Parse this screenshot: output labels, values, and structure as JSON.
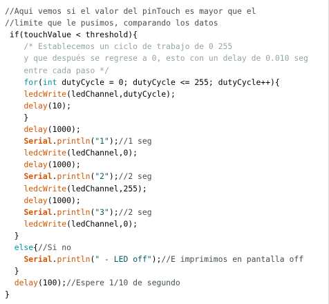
{
  "colors": {
    "background": "#ffffff",
    "plain": "#000000",
    "comment": "#434f54",
    "doc": "#95a5a6",
    "keyword": "#00979c",
    "func": "#d35400",
    "serial": "#d35400",
    "string": "#005c5f"
  },
  "code": {
    "lines": [
      [
        {
          "t": "//Aqui vemos si el valor del pinTouch es mayor que el",
          "c": "comment"
        }
      ],
      [
        {
          "t": "//limite que le pusimos, comparando los datos",
          "c": "comment"
        }
      ],
      [
        {
          "t": " if(touchValue < threshold){",
          "c": "plain"
        }
      ],
      [
        {
          "t": "    /* Establecemos un ciclo de trabajo de 0 255",
          "c": "doc"
        }
      ],
      [
        {
          "t": "    y que después se regrese a 0, esto con un delay de 0.010 seg",
          "c": "doc"
        }
      ],
      [
        {
          "t": "    entre cada paso */",
          "c": "doc"
        }
      ],
      [
        {
          "t": "    ",
          "c": "plain"
        },
        {
          "t": "for",
          "c": "keyword"
        },
        {
          "t": "(",
          "c": "plain"
        },
        {
          "t": "int",
          "c": "keyword"
        },
        {
          "t": " dutyCycle = 0; dutyCycle <= 255; dutyCycle++){",
          "c": "plain"
        }
      ],
      [
        {
          "t": "    ",
          "c": "plain"
        },
        {
          "t": "ledcWrite",
          "c": "func"
        },
        {
          "t": "(ledChannel,dutyCycle);",
          "c": "plain"
        }
      ],
      [
        {
          "t": "    ",
          "c": "plain"
        },
        {
          "t": "delay",
          "c": "func"
        },
        {
          "t": "(10);",
          "c": "plain"
        }
      ],
      [
        {
          "t": "    }",
          "c": "plain"
        }
      ],
      [
        {
          "t": "    ",
          "c": "plain"
        },
        {
          "t": "delay",
          "c": "func"
        },
        {
          "t": "(1000);",
          "c": "plain"
        }
      ],
      [
        {
          "t": "    ",
          "c": "plain"
        },
        {
          "t": "Serial",
          "c": "serial"
        },
        {
          "t": ".",
          "c": "plain"
        },
        {
          "t": "println",
          "c": "func"
        },
        {
          "t": "(",
          "c": "plain"
        },
        {
          "t": "\"1\"",
          "c": "string"
        },
        {
          "t": ");",
          "c": "plain"
        },
        {
          "t": "//1 seg",
          "c": "comment"
        }
      ],
      [
        {
          "t": "    ",
          "c": "plain"
        },
        {
          "t": "ledcWrite",
          "c": "func"
        },
        {
          "t": "(ledChannel,0);",
          "c": "plain"
        }
      ],
      [
        {
          "t": "    ",
          "c": "plain"
        },
        {
          "t": "delay",
          "c": "func"
        },
        {
          "t": "(1000);",
          "c": "plain"
        }
      ],
      [
        {
          "t": "    ",
          "c": "plain"
        },
        {
          "t": "Serial",
          "c": "serial"
        },
        {
          "t": ".",
          "c": "plain"
        },
        {
          "t": "println",
          "c": "func"
        },
        {
          "t": "(",
          "c": "plain"
        },
        {
          "t": "\"2\"",
          "c": "string"
        },
        {
          "t": ");",
          "c": "plain"
        },
        {
          "t": "//2 seg",
          "c": "comment"
        }
      ],
      [
        {
          "t": "    ",
          "c": "plain"
        },
        {
          "t": "ledcWrite",
          "c": "func"
        },
        {
          "t": "(ledChannel,255);",
          "c": "plain"
        }
      ],
      [
        {
          "t": "    ",
          "c": "plain"
        },
        {
          "t": "delay",
          "c": "func"
        },
        {
          "t": "(1000);",
          "c": "plain"
        }
      ],
      [
        {
          "t": "    ",
          "c": "plain"
        },
        {
          "t": "Serial",
          "c": "serial"
        },
        {
          "t": ".",
          "c": "plain"
        },
        {
          "t": "println",
          "c": "func"
        },
        {
          "t": "(",
          "c": "plain"
        },
        {
          "t": "\"3\"",
          "c": "string"
        },
        {
          "t": ");",
          "c": "plain"
        },
        {
          "t": "//2 seg",
          "c": "comment"
        }
      ],
      [
        {
          "t": "    ",
          "c": "plain"
        },
        {
          "t": "ledcWrite",
          "c": "func"
        },
        {
          "t": "(ledChannel,0);",
          "c": "plain"
        }
      ],
      [
        {
          "t": "  }",
          "c": "plain"
        }
      ],
      [
        {
          "t": "  ",
          "c": "plain"
        },
        {
          "t": "else",
          "c": "keyword"
        },
        {
          "t": "{",
          "c": "plain"
        },
        {
          "t": "//Si no",
          "c": "comment"
        }
      ],
      [
        {
          "t": "    ",
          "c": "plain"
        },
        {
          "t": "Serial",
          "c": "serial"
        },
        {
          "t": ".",
          "c": "plain"
        },
        {
          "t": "println",
          "c": "func"
        },
        {
          "t": "(",
          "c": "plain"
        },
        {
          "t": "\" - LED off\"",
          "c": "string"
        },
        {
          "t": ");",
          "c": "plain"
        },
        {
          "t": "//E imprimimos en pantalla off",
          "c": "comment"
        }
      ],
      [
        {
          "t": "  }",
          "c": "plain"
        }
      ],
      [
        {
          "t": "  ",
          "c": "plain"
        },
        {
          "t": "delay",
          "c": "func"
        },
        {
          "t": "(100);",
          "c": "plain"
        },
        {
          "t": "//Espere 1/10 de segundo",
          "c": "comment"
        }
      ],
      [
        {
          "t": "}",
          "c": "plain"
        }
      ]
    ]
  }
}
